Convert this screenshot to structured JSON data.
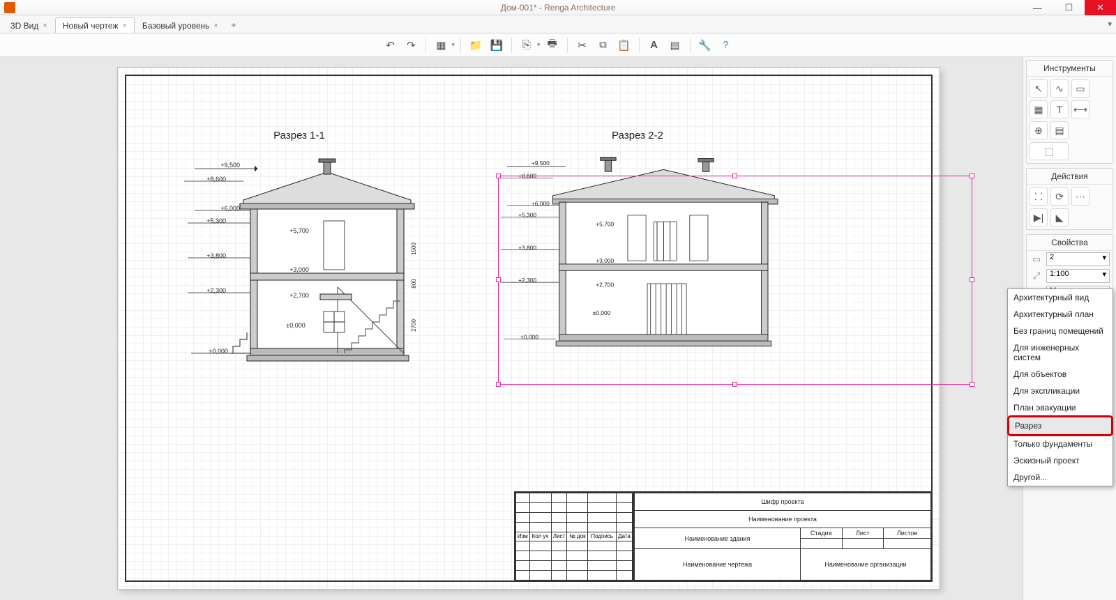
{
  "title": "Дом-001* - Renga Architecture",
  "tabs": [
    {
      "label": "3D Вид",
      "active": false
    },
    {
      "label": "Новый чертеж",
      "active": true
    },
    {
      "label": "Базовый уровень",
      "active": false
    }
  ],
  "sections": [
    {
      "title": "Разрез 1-1"
    },
    {
      "title": "Разрез 2-2"
    }
  ],
  "elevations": {
    "top": [
      "+9,500",
      "+8,600"
    ],
    "left": [
      "+6,000",
      "+5,300",
      "+3,800",
      "+2,300",
      "±0,000"
    ],
    "inner": [
      "+5,700",
      "+3,000",
      "+2,700",
      "±0,000"
    ]
  },
  "dims_right": [
    "1500",
    "800",
    "2700"
  ],
  "titleblock": {
    "r1": "Шифр проекта",
    "r2": "Наименование проекта",
    "r3": "Наименование здания",
    "r3c": [
      "Стадия",
      "Лист",
      "Листов"
    ],
    "r4": "Наименование чертежа",
    "r4b": "Наименование организации",
    "side_head": [
      "Изм",
      "Кол уч",
      "Лист",
      "№ док",
      "Подпись",
      "Дата"
    ]
  },
  "panels": {
    "instruments": "Инструменты",
    "actions": "Действия",
    "properties": "Свойства"
  },
  "properties": {
    "section": "2",
    "scale": "1:100",
    "style": "Монохромнь",
    "viewtype": "Разрез"
  },
  "dropdown": [
    "Архитектурный вид",
    "Архитектурный план",
    "Без границ помещений",
    "Для инженерных систем",
    "Для объектов",
    "Для экспликации",
    "План эвакуации",
    "Разрез",
    "Только фундаменты",
    "Эскизный проект",
    "Другой..."
  ],
  "dropdown_selected": "Разрез"
}
